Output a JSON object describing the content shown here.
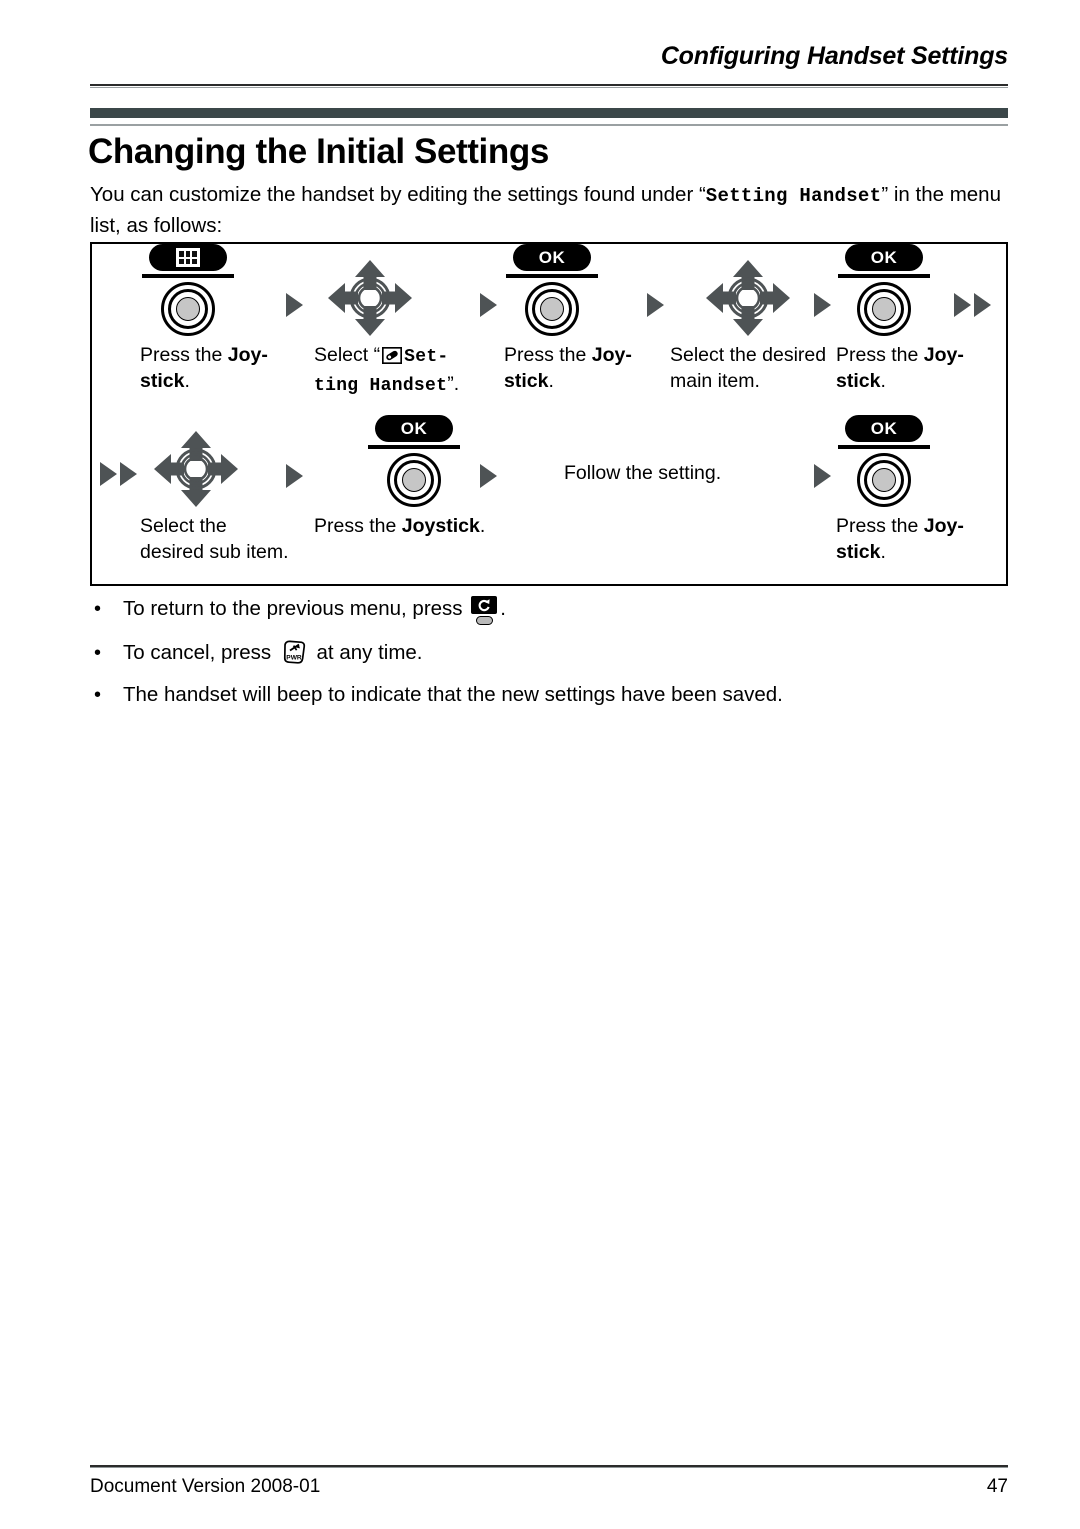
{
  "header": {
    "running_head": "Configuring Handset Settings"
  },
  "title": "Changing the Initial Settings",
  "intro": {
    "part1": "You can customize the handset by editing the settings found under “",
    "mono": "Setting Handset",
    "part2": "” in the menu list, as follows:"
  },
  "flow": {
    "steps": [
      {
        "id": "press-joystick-1",
        "art": "menu-key-over-joystick",
        "icon_names": [
          "menu-grid-icon",
          "joystick-icon"
        ],
        "caption_plain": "Press the ",
        "caption_bold": "Joy-",
        "caption_bold2": "stick",
        "caption_tail": "."
      },
      {
        "id": "select-setting-handset",
        "art": "four-way-nav",
        "icon_names": [
          "four-way-nav-icon"
        ],
        "caption_lead": "Select “",
        "caption_icon": "handset-settings-icon",
        "caption_mono1": "Set-",
        "caption_mono2": "ting Handset",
        "caption_tail": "”."
      },
      {
        "id": "press-joystick-2",
        "art": "ok-key-over-joystick",
        "icon_names": [
          "ok-key-icon",
          "joystick-icon"
        ],
        "key_label": "OK",
        "caption_plain": "Press the ",
        "caption_bold": "Joy-",
        "caption_bold2": "stick",
        "caption_tail": "."
      },
      {
        "id": "select-main-item",
        "art": "four-way-nav",
        "icon_names": [
          "four-way-nav-icon"
        ],
        "caption_line1": "Select the desired",
        "caption_line2": "main item."
      },
      {
        "id": "press-joystick-3",
        "art": "ok-key-over-joystick",
        "icon_names": [
          "ok-key-icon",
          "joystick-icon"
        ],
        "key_label": "OK",
        "caption_plain": "Press the ",
        "caption_bold": "Joy-",
        "caption_bold2": "stick",
        "caption_tail": "."
      },
      {
        "id": "select-sub-item",
        "art": "four-way-nav",
        "icon_names": [
          "four-way-nav-icon"
        ],
        "caption_line1": "Select the",
        "caption_line2": "desired sub item."
      },
      {
        "id": "press-joystick-4",
        "art": "ok-key-over-joystick",
        "icon_names": [
          "ok-key-icon",
          "joystick-icon"
        ],
        "key_label": "OK",
        "caption_plain": "Press the ",
        "caption_bold": "Joystick",
        "caption_tail": "."
      },
      {
        "id": "follow-the-setting",
        "art": "none",
        "caption_plain": "Follow the setting."
      },
      {
        "id": "press-joystick-5",
        "art": "ok-key-over-joystick",
        "icon_names": [
          "ok-key-icon",
          "joystick-icon"
        ],
        "key_label": "OK",
        "caption_plain": "Press the ",
        "caption_bold": "Joy-",
        "caption_bold2": "stick",
        "caption_tail": "."
      }
    ],
    "ok_label": "OK"
  },
  "bullets": [
    {
      "marker": "•",
      "text_before": "To return to the previous menu, press ",
      "icon": "back-key-icon",
      "text_after": "."
    },
    {
      "marker": "•",
      "text_before": "To cancel, press ",
      "icon": "power-key-icon",
      "text_after": " at any time."
    },
    {
      "marker": "•",
      "text_before": "The handset will beep to indicate that the new settings have been saved.",
      "icon": "",
      "text_after": ""
    }
  ],
  "footer": {
    "document_version": "Document Version  2008-01",
    "page_number": "47"
  },
  "colors": {
    "rule_dark": "#2b2b2b",
    "rule_light": "#9aa0a2",
    "title_band": "#3b4749",
    "arrow_gray": "#4e5355",
    "joystick_fill": "#c6c6c6",
    "key_black": "#000000"
  }
}
